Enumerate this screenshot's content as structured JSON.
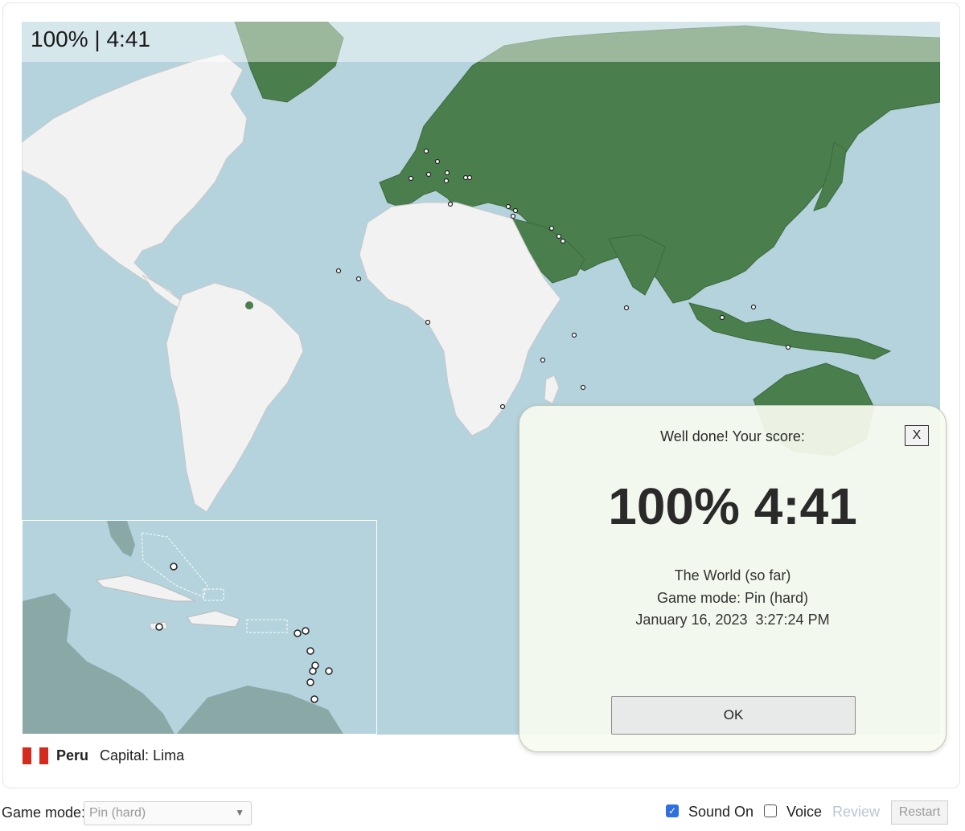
{
  "hud": {
    "score_time": "100% | 4:41"
  },
  "dialog": {
    "heading": "Well done! Your score:",
    "close_label": "X",
    "big_score": "100% 4:41",
    "quiz_name": "The World (so far)",
    "game_mode": "Game mode: Pin (hard)",
    "timestamp": "January 16, 2023  3:27:24 PM",
    "ok_label": "OK"
  },
  "current": {
    "country": "Peru",
    "capital": "Capital: Lima",
    "flag_colors": [
      "#d52b1e",
      "#ffffff",
      "#d52b1e"
    ]
  },
  "controls": {
    "game_mode_label": "Game mode:",
    "game_mode_value": "Pin (hard)",
    "sound_label": "Sound On",
    "sound_checked": true,
    "voice_label": "Voice",
    "voice_checked": false,
    "review_label": "Review",
    "restart_label": "Restart"
  },
  "colors": {
    "ocean": "#b4d3dc",
    "unanswered_land": "#f2f2f2",
    "answered_land": "#4a7f4d",
    "accent_blue": "#2f6fde"
  },
  "icons": {
    "close": "close-icon",
    "select": "chevron-down-icon",
    "checkbox": "checkmark-icon"
  }
}
